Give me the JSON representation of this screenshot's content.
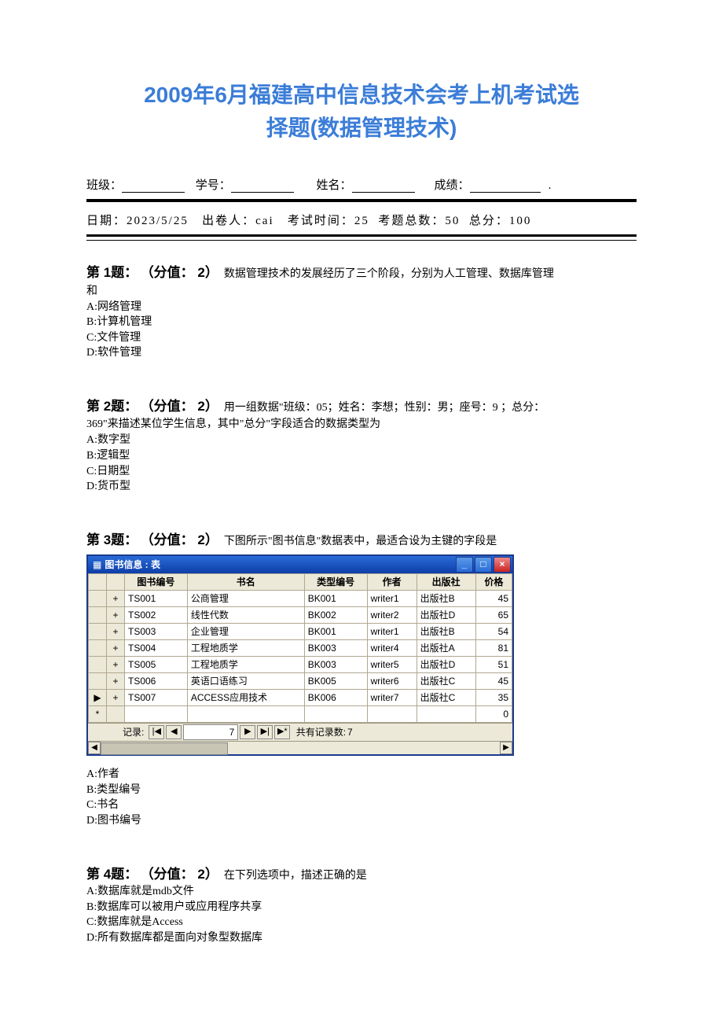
{
  "title_line1": "2009年6月福建高中信息技术会考上机考试选",
  "title_line2": "择题(数据管理技术)",
  "header": {
    "class_label": "班级：",
    "id_label": "学号：",
    "name_label": "姓名：",
    "score_label": "成绩："
  },
  "meta": {
    "date_label": "日期：",
    "date_value": "2023/5/25",
    "author_label": "出卷人：",
    "author_value": "cai",
    "duration_label": "考试时间：",
    "duration_value": "25",
    "qcount_label": "考题总数：",
    "qcount_value": "50",
    "total_label": "总分：",
    "total_value": "100"
  },
  "questions": [
    {
      "num": "第 1题：",
      "score": "（分值： 2）",
      "text1": "数据管理技术的发展经历了三个阶段，分别为人工管理、数据库管理",
      "text2": "和",
      "options": [
        "A:网络管理",
        "B:计算机管理",
        "C:文件管理",
        "D:软件管理"
      ]
    },
    {
      "num": "第 2题：",
      "score": "（分值： 2）",
      "text1": "用一组数据\"班级：05；姓名：李想；性别：男；座号：9 ；总分：",
      "text2": "369\"来描述某位学生信息，其中\"总分\"字段适合的数据类型为",
      "options": [
        "A:数字型",
        "B:逻辑型",
        "C:日期型",
        "D:货币型"
      ]
    },
    {
      "num": "第 3题：",
      "score": "（分值： 2）",
      "text1": "下图所示\"图书信息\"数据表中，最适合设为主键的字段是",
      "options": [
        "A:作者",
        "B:类型编号",
        "C:书名",
        "D:图书编号"
      ]
    },
    {
      "num": "第 4题：",
      "score": "（分值： 2）",
      "text1": "在下列选项中，描述正确的是",
      "options": [
        "A:数据库就是mdb文件",
        "B:数据库可以被用户或应用程序共享",
        "C:数据库就是Access",
        "D:所有数据库都是面向对象型数据库"
      ]
    }
  ],
  "db": {
    "title": "图书信息 : 表",
    "columns_sel": "",
    "columns": [
      "图书编号",
      "书名",
      "类型编号",
      "作者",
      "出版社",
      "价格"
    ],
    "rows": [
      {
        "sel": "+",
        "c": [
          "TS001",
          "公商管理",
          "BK001",
          "writer1",
          "出版社B",
          "45"
        ]
      },
      {
        "sel": "+",
        "c": [
          "TS002",
          "线性代数",
          "BK002",
          "writer2",
          "出版社D",
          "65"
        ]
      },
      {
        "sel": "+",
        "c": [
          "TS003",
          "企业管理",
          "BK001",
          "writer1",
          "出版社B",
          "54"
        ]
      },
      {
        "sel": "+",
        "c": [
          "TS004",
          "工程地质学",
          "BK003",
          "writer4",
          "出版社A",
          "81"
        ]
      },
      {
        "sel": "+",
        "c": [
          "TS005",
          "工程地质学",
          "BK003",
          "writer5",
          "出版社D",
          "51"
        ]
      },
      {
        "sel": "+",
        "c": [
          "TS006",
          "英语口语练习",
          "BK005",
          "writer6",
          "出版社C",
          "45"
        ]
      },
      {
        "sel": "+",
        "c": [
          "TS007",
          "ACCESS应用技术",
          "BK006",
          "writer7",
          "出版社C",
          "35"
        ]
      }
    ],
    "current_marker": "▶",
    "new_marker": "*",
    "new_price": "0",
    "nav": {
      "label": "记录:",
      "first": "|◀",
      "prev": "◀",
      "pos": "7",
      "next": "▶",
      "last": "▶|",
      "new": "▶*",
      "count_label": "共有记录数:",
      "count": "7"
    }
  }
}
